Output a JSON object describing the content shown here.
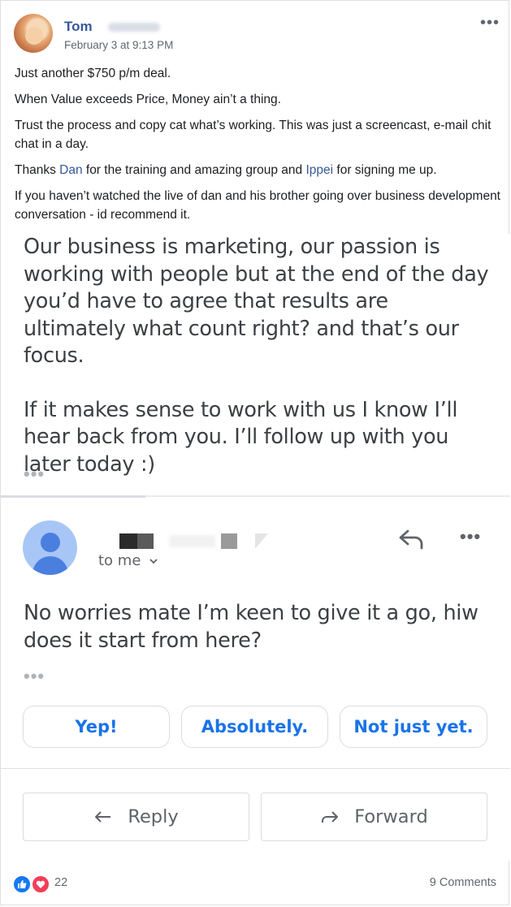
{
  "post": {
    "author": "Tom",
    "date": "February 3 at 9:13 PM",
    "more_icon": "more-horizontal-icon",
    "paragraphs": {
      "p1": "Just another $750 p/m deal.",
      "p2": "When Value exceeds Price, Money ain’t a thing.",
      "p3": "Trust the process and copy cat what’s working. This was just a screencast, e-mail chit chat in a day.",
      "p4_before": "Thanks ",
      "p4_link1": "Dan",
      "p4_middle": " for the training and amazing group and ",
      "p4_link2": "Ippei",
      "p4_after": " for signing me up.",
      "p5": "If you haven’t watched the live of dan and his brother going over business development conversation - id recommend it."
    }
  },
  "email": {
    "body_para1": "Our business is marketing, our passion is working with people but at the end of the day you’d have to agree that results are ultimately what count right? and that’s our focus.",
    "body_para2": "If it makes sense to work with us I know I’ll hear back from you. I’ll follow up with you later today :)",
    "recipient": "to me",
    "reply_text": "No worries mate I’m keen to give it a go, hiw does it start from here?",
    "smart_replies": [
      "Yep!",
      "Absolutely.",
      "Not just yet."
    ],
    "reply_label": "Reply",
    "forward_label": "Forward",
    "icons": [
      "reply-icon",
      "more-icon",
      "chevron-down-icon",
      "forward-icon"
    ],
    "colors": {
      "accent": "#1a73e8",
      "avatar_bg": "#a8c6f5",
      "avatar_fg": "#4a7fe0"
    }
  },
  "footer": {
    "reaction_count": "22",
    "comments_label": "9 Comments",
    "reactions": [
      "like-icon",
      "love-icon"
    ]
  }
}
